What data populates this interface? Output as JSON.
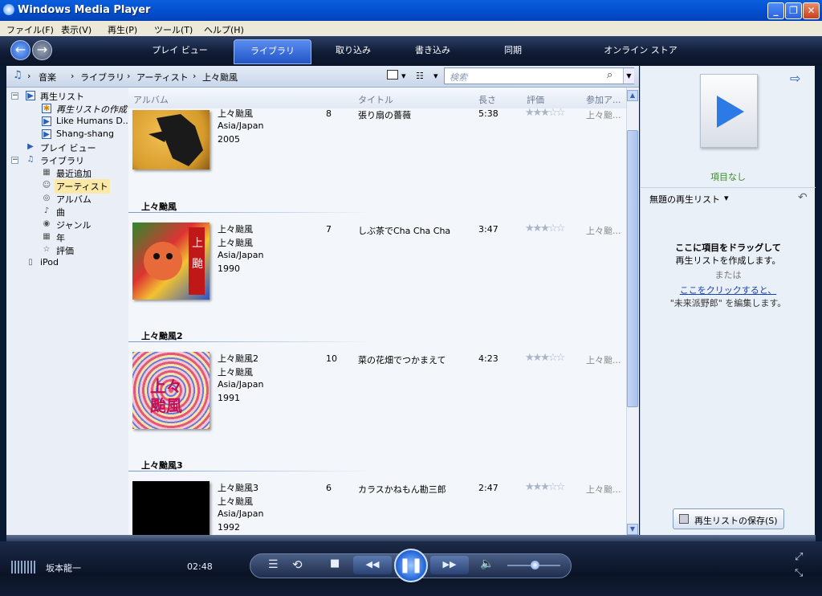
{
  "window": {
    "title": "Windows Media Player",
    "controls": [
      "_",
      "❐",
      "✕"
    ]
  },
  "menu": [
    "ファイル(F)",
    "表示(V)",
    "再生(P)",
    "ツール(T)",
    "ヘルプ(H)"
  ],
  "tabs": [
    "プレイ ビュー",
    "ライブラリ",
    "取り込み",
    "書き込み",
    "同期",
    "オンライン ストア"
  ],
  "breadcrumb": {
    "items": [
      "音楽",
      "ライブラリ",
      "アーティスト",
      "上々颱風"
    ],
    "search_placeholder": "検索"
  },
  "tree": {
    "playlists": "再生リスト",
    "create_playlist": "再生リストの作成",
    "pl1": "Like Humans D...",
    "pl2": "Shang-shang",
    "now_playing": "プレイ ビュー",
    "library": "ライブラリ",
    "recent": "最近追加",
    "artist": "アーティスト",
    "album": "アルバム",
    "song": "曲",
    "genre": "ジャンル",
    "year": "年",
    "rating": "評価",
    "ipod": "iPod"
  },
  "columns": {
    "album": "アルバム",
    "title": "タイトル",
    "length": "長さ",
    "rating": "評価",
    "contributing": "参加ア..."
  },
  "rows": [
    {
      "group": "",
      "artist": "上々颱風",
      "album": "",
      "genre": "Asia/Japan",
      "year": "2005",
      "track": "8",
      "title": "張り扇の薔薇",
      "length": "5:38",
      "contrib": "上々颱..."
    },
    {
      "group": "上々颱風",
      "artist": "上々颱風",
      "album": "上々颱風",
      "genre": "Asia/Japan",
      "year": "1990",
      "track": "7",
      "title": "しぶ茶でCha Cha Cha",
      "length": "3:47",
      "contrib": "上々颱..."
    },
    {
      "group": "上々颱風2",
      "artist": "上々颱風2",
      "album": "上々颱風",
      "genre": "Asia/Japan",
      "year": "1991",
      "track": "10",
      "title": "菜の花畑でつかまえて",
      "length": "4:23",
      "contrib": "上々颱..."
    },
    {
      "group": "上々颱風3",
      "artist": "上々颱風3",
      "album": "上々颱風",
      "genre": "Asia/Japan",
      "year": "1992",
      "track": "6",
      "title": "カラスかねもん勘三郎",
      "length": "2:47",
      "contrib": "上々颱..."
    }
  ],
  "right": {
    "no_items": "項目なし",
    "playlist_name": "無題の再生リスト",
    "drag_line1": "ここに項目をドラッグして",
    "drag_line2": "再生リストを作成します。",
    "or": "または",
    "click_here": "ここをクリックすると、",
    "edit_line": "\"未来派野郎\" を編集します。",
    "save_button": "再生リストの保存(S)"
  },
  "player": {
    "artist": "坂本龍一",
    "time": "02:48"
  },
  "colors": {
    "accent": "#2c6fe0",
    "title": "#0553d4",
    "no_items": "#3a8a2a"
  }
}
